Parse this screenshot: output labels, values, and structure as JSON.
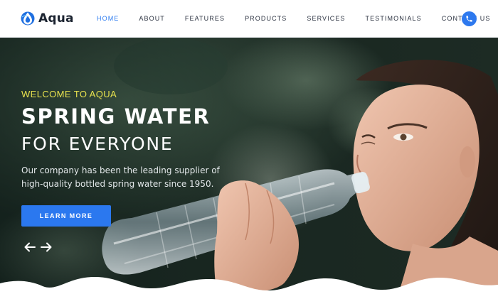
{
  "brand": {
    "name": "Aqua",
    "logo_icon": "water-drop-globe-icon",
    "accent_color": "#2e79ee"
  },
  "nav": {
    "items": [
      {
        "label": "HOME",
        "active": true
      },
      {
        "label": "ABOUT",
        "active": false
      },
      {
        "label": "FEATURES",
        "active": false
      },
      {
        "label": "PRODUCTS",
        "active": false
      },
      {
        "label": "SERVICES",
        "active": false
      },
      {
        "label": "TESTIMONIALS",
        "active": false
      },
      {
        "label": "CONTACT US",
        "active": false
      }
    ],
    "phone_icon": "phone-icon"
  },
  "hero": {
    "eyebrow": "WELCOME TO AQUA",
    "headline": "SPRING WATER",
    "subheadline": "FOR EVERYONE",
    "description": "Our company has been the leading supplier of high-quality bottled spring water since 1950.",
    "cta_label": "LEARN MORE",
    "prev_icon": "arrow-left-icon",
    "next_icon": "arrow-right-icon",
    "eyebrow_color": "#e7e14e",
    "cta_color": "#2b78ef"
  }
}
